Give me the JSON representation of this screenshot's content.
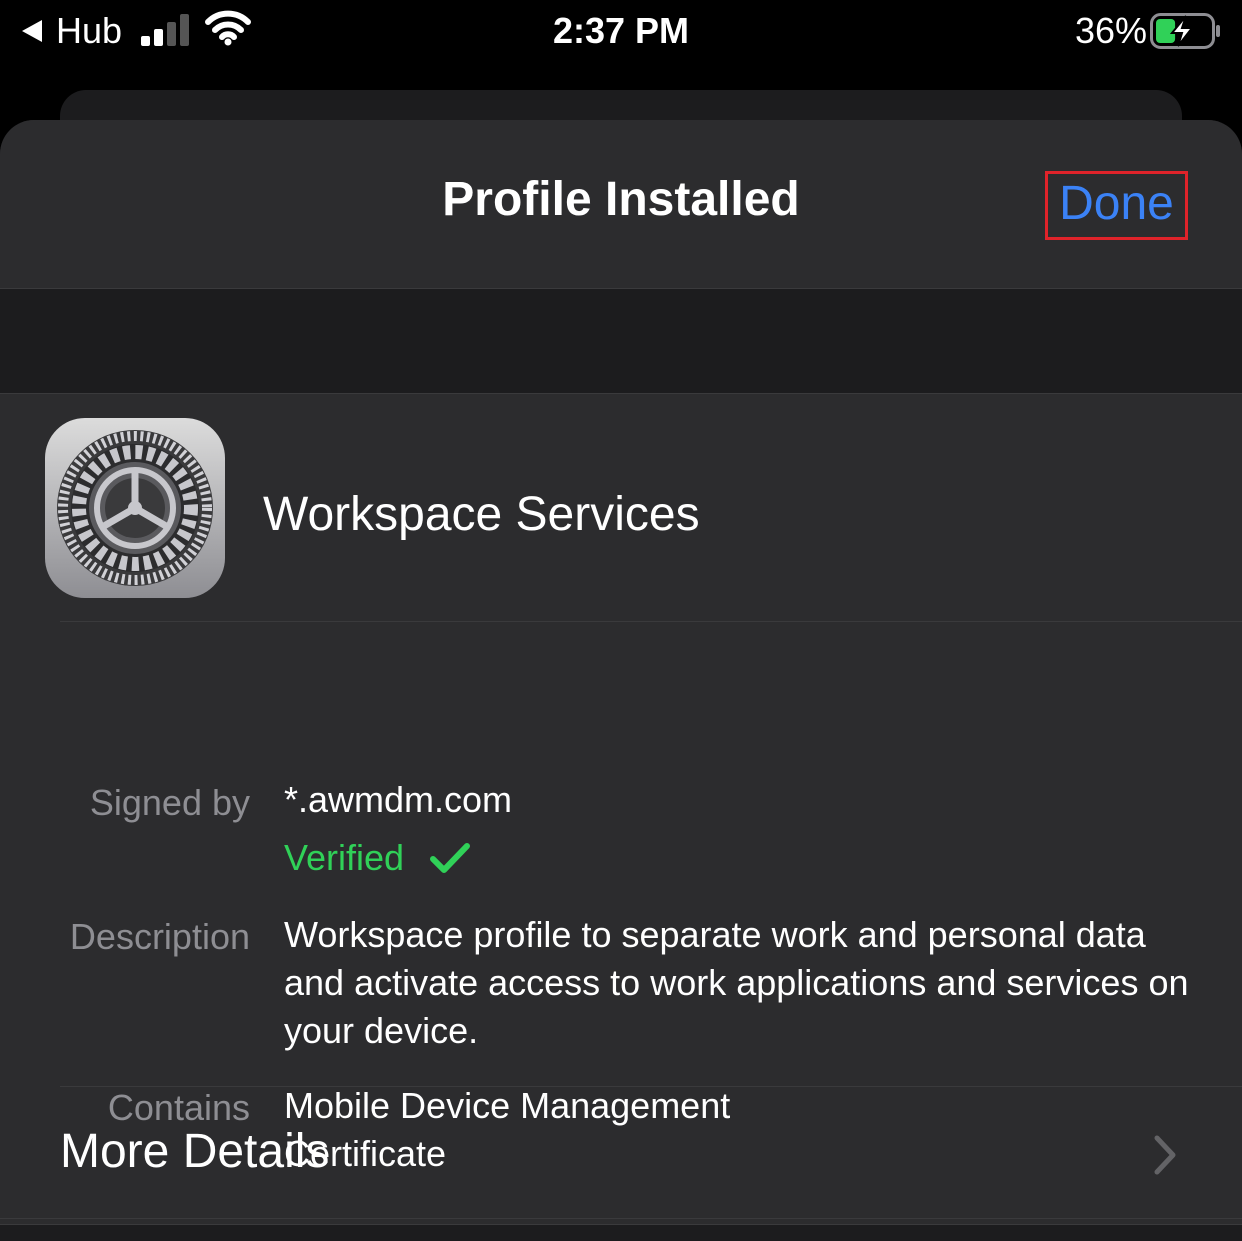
{
  "status_bar": {
    "back_app_label": "Hub",
    "time": "2:37 PM",
    "battery_percent": "36%",
    "signal_bars_filled": 2,
    "battery_level": 0.36,
    "charging": true
  },
  "nav": {
    "title": "Profile Installed",
    "done_label": "Done"
  },
  "profile": {
    "icon": "settings-gear-icon",
    "name": "Workspace Services",
    "signed_by_label": "Signed by",
    "signed_by_value": "*.awmdm.com",
    "verified_label": "Verified",
    "description_label": "Description",
    "description_value": "Workspace profile to separate work and personal data and activate access to work applications and services on your device.",
    "contains_label": "Contains",
    "contains_line1": "Mobile Device Management",
    "contains_line2": "Certificate"
  },
  "more_details_label": "More Details",
  "colors": {
    "accent_blue": "#3b82f6",
    "verified_green": "#30d158",
    "highlight_red": "#e0232a"
  }
}
